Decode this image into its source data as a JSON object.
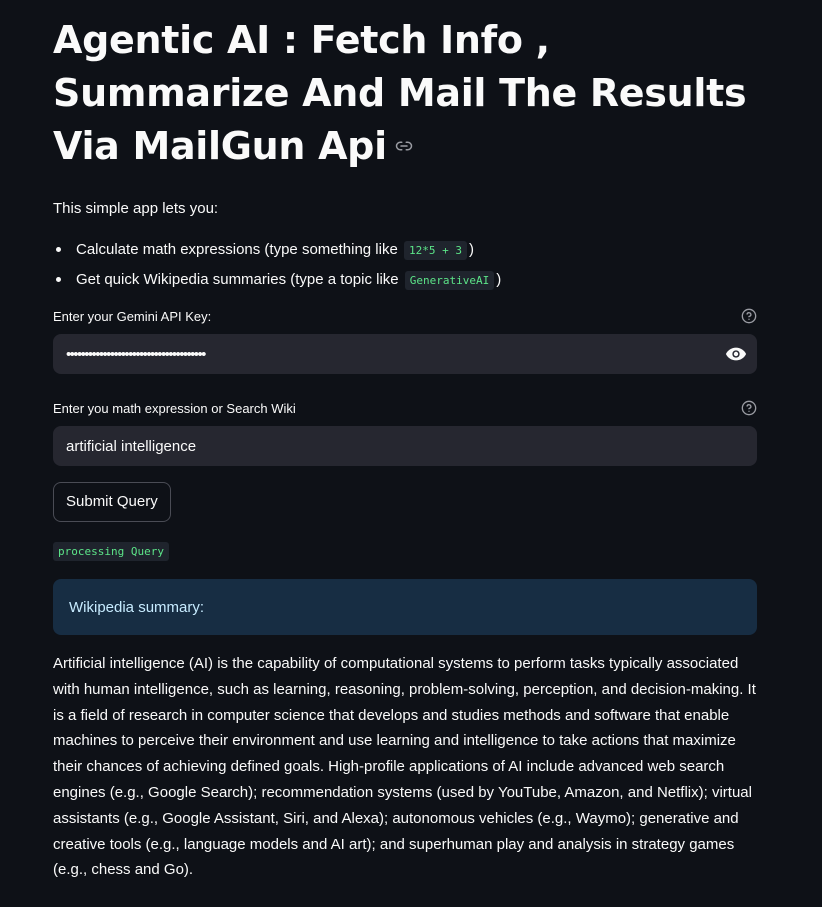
{
  "app": {
    "title": "Agentic AI : Fetch Info , Summarize And Mail The Results Via MailGun Api",
    "intro": "This simple app lets you:",
    "bullets": [
      {
        "text": "Calculate math expressions (type something like ",
        "code": "12*5 + 3",
        "suffix": ")"
      },
      {
        "text": "Get quick Wikipedia summaries (type a topic like ",
        "code": "GenerativeAI",
        "suffix": ")"
      }
    ]
  },
  "api_key_field": {
    "label": "Enter your Gemini API Key:",
    "masked_value": "••••••••••••••••••••••••••••••••••••••"
  },
  "query_field": {
    "label": "Enter you math expression or Search Wiki",
    "value": "artificial intelligence"
  },
  "submit_button": {
    "label": "Submit Query"
  },
  "status": {
    "text": "processing Query"
  },
  "info_box": {
    "text": "Wikipedia summary:"
  },
  "summary": {
    "text": "Artificial intelligence (AI) is the capability of computational systems to perform tasks typically associated with human intelligence, such as learning, reasoning, problem-solving, perception, and decision-making. It is a field of research in computer science that develops and studies methods and software that enable machines to perceive their environment and use learning and intelligence to take actions that maximize their chances of achieving defined goals. High-profile applications of AI include advanced web search engines (e.g., Google Search); recommendation systems (used by YouTube, Amazon, and Netflix); virtual assistants (e.g., Google Assistant, Siri, and Alexa); autonomous vehicles (e.g., Waymo); generative and creative tools (e.g., language models and AI art); and superhuman play and analysis in strategy games (e.g., chess and Go)."
  },
  "colors": {
    "background": "#0e1117",
    "input_bg": "#262730",
    "code_green": "#5ce488",
    "info_bg": "#172d43",
    "info_text": "#c7ebff"
  },
  "icons": {
    "title_anchor": "link-icon",
    "help": "help-circle-icon",
    "password_toggle": "eye-icon"
  }
}
